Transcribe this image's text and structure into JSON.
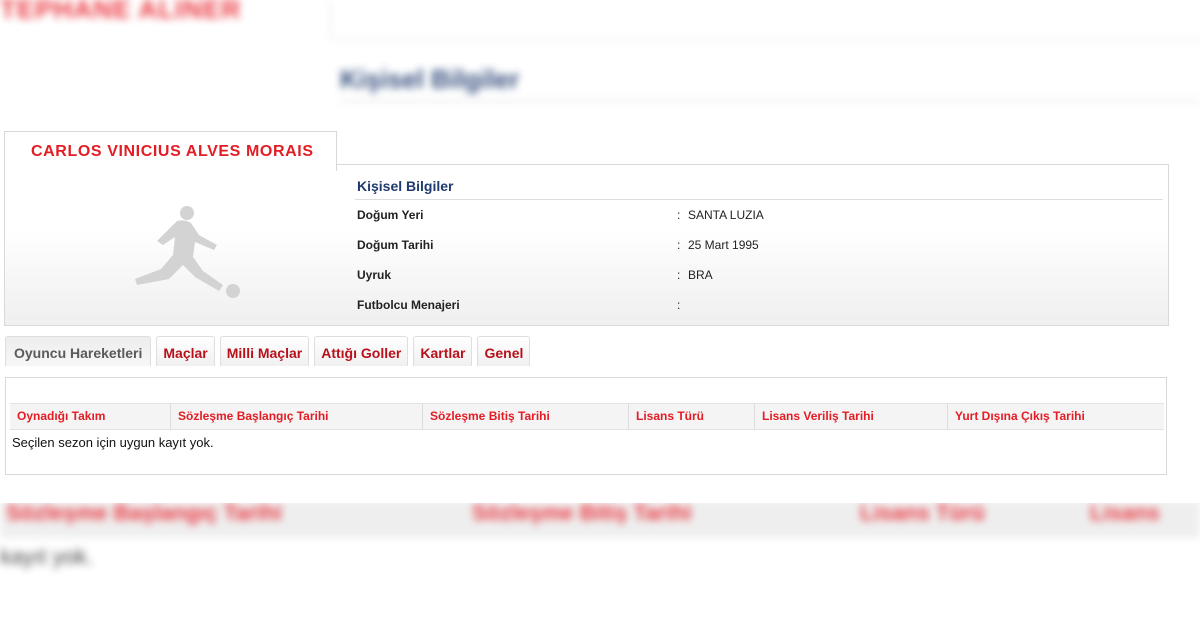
{
  "background": {
    "top_title": "TEPHANE ALINER",
    "section_title": "Kişisel Bilgiler",
    "bottom_headers": [
      "Sözleşme Başlangıç Tarihi",
      "Sözleşme Bitiş Tarihi",
      "Lisans Türü",
      "Lisans"
    ],
    "bottom_message": "kayıt yok."
  },
  "player": {
    "name": "CARLOS VINICIUS ALVES MORAIS",
    "image_icon": "footballer-silhouette-icon"
  },
  "personal_info": {
    "title": "Kişisel Bilgiler",
    "rows": [
      {
        "label": "Doğum Yeri",
        "sep": ":",
        "value": "SANTA LUZIA"
      },
      {
        "label": "Doğum Tarihi",
        "sep": ":",
        "value": "25 Mart 1995"
      },
      {
        "label": "Uyruk",
        "sep": ":",
        "value": "BRA"
      },
      {
        "label": "Futbolcu Menajeri",
        "sep": ":",
        "value": ""
      }
    ]
  },
  "tabs": [
    {
      "label": "Oyuncu Hareketleri",
      "active": true
    },
    {
      "label": "Maçlar",
      "active": false
    },
    {
      "label": "Milli Maçlar",
      "active": false
    },
    {
      "label": "Attığı Goller",
      "active": false
    },
    {
      "label": "Kartlar",
      "active": false
    },
    {
      "label": "Genel",
      "active": false
    }
  ],
  "table": {
    "columns": [
      "Oynadığı Takım",
      "Sözleşme Başlangıç Tarihi",
      "Sözleşme Bitiş Tarihi",
      "Lisans Türü",
      "Lisans Veriliş Tarihi",
      "Yurt Dışına Çıkış Tarihi"
    ],
    "empty_message": "Seçilen sezon için uygun kayıt yok."
  },
  "colors": {
    "accent_red": "#e41c24",
    "tab_red": "#b8111a",
    "title_blue": "#1e3a6e"
  }
}
